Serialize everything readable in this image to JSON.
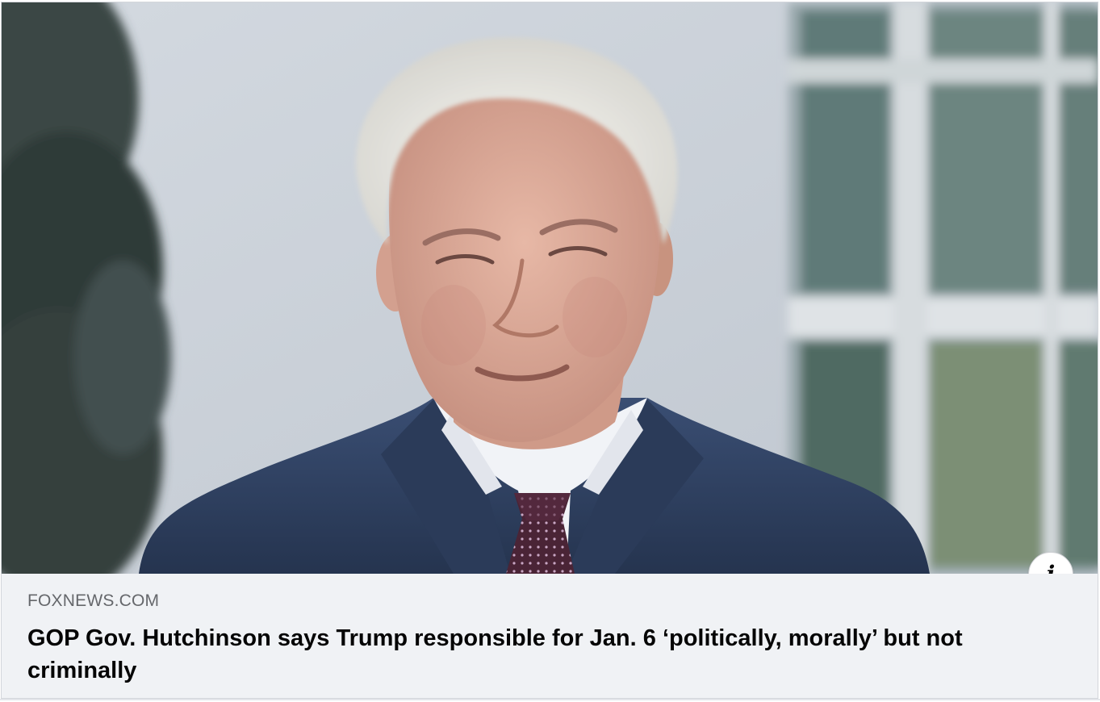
{
  "link_preview": {
    "image": {
      "alt": "",
      "colors": {
        "wall": "#c9d0d8",
        "suit": "#2d3e5c",
        "shirt": "#f1f3f7",
        "tie": "#4a2436",
        "skin": "#d9a796",
        "hair": "#ecebe6",
        "foliage": "#2e3a38",
        "window_frame": "#dfe3e6",
        "window_glass": "#5f7a78"
      }
    },
    "info_icon": {
      "glyph": "i",
      "icon": "info-icon"
    },
    "domain": "FOXNEWS.COM",
    "headline": "GOP Gov. Hutchinson says Trump responsible for Jan. 6 ‘politically, morally’ but not criminally"
  }
}
